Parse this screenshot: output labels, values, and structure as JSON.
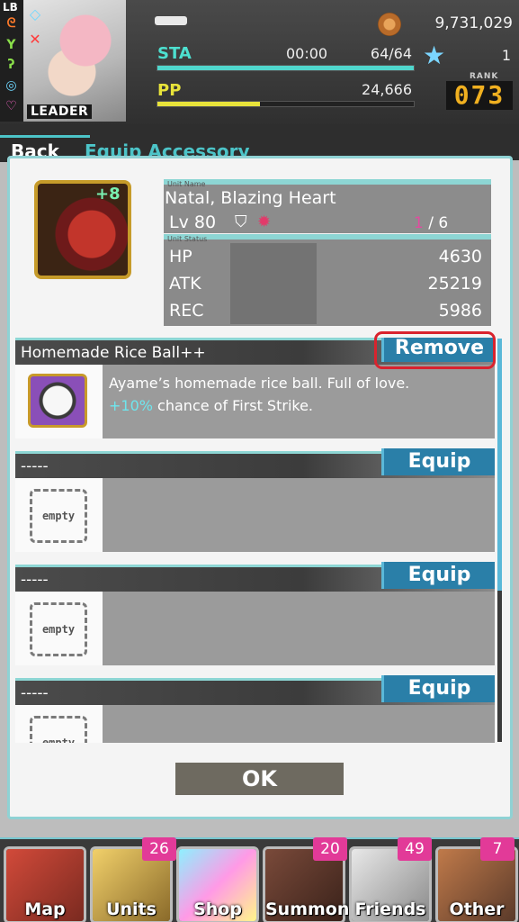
{
  "header": {
    "lb_label": "LB",
    "leader_label": "LEADER",
    "gold": "9,731,029",
    "sta_label": "STA",
    "sta_timer": "00:00",
    "sta_value": "64/64",
    "sta_fill": 1.0,
    "pp_label": "PP",
    "pp_value": "24,666",
    "pp_fill": 0.4,
    "gems": "1",
    "rank_label": "RANK",
    "rank_value": "073"
  },
  "nav": {
    "back_label": "Back",
    "page_title": "Equip Accessory"
  },
  "unit": {
    "name_header": "Unit Name",
    "plus": "+8",
    "name": "Natal, Blazing Heart",
    "level": "Lv  80",
    "slots_current": "1",
    "slots_total": " / 6",
    "status_header": "Unit Status",
    "stats": [
      {
        "label": "HP",
        "value": "4630"
      },
      {
        "label": "ATK",
        "value": "25219"
      },
      {
        "label": "REC",
        "value": "5986"
      }
    ]
  },
  "accessories": [
    {
      "name": "Homemade Rice Ball++",
      "desc_a": "Ayame’s homemade rice ball. Full of love. ",
      "desc_hl": "+10%",
      "desc_b": " chance of First Strike.",
      "button": "Remove"
    },
    {
      "name": "-----",
      "empty_label": "empty",
      "button": "Equip"
    },
    {
      "name": "-----",
      "empty_label": "empty",
      "button": "Equip"
    },
    {
      "name": "-----",
      "empty_label": "empty",
      "button": "Equip"
    }
  ],
  "ok_label": "OK",
  "bottom_nav": [
    {
      "label": "Map",
      "badge": ""
    },
    {
      "label": "Units",
      "badge": "26"
    },
    {
      "label": "Shop",
      "badge": ""
    },
    {
      "label": "Summon",
      "badge": "20"
    },
    {
      "label": "Friends",
      "badge": "49"
    },
    {
      "label": "Other",
      "badge": "7"
    }
  ],
  "colors": {
    "accent": "#4cc4c8",
    "badge": "#e23a98",
    "highlight": "#d9232e"
  }
}
